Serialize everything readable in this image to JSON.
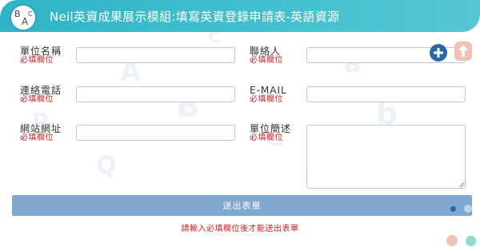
{
  "header": {
    "logo_letters": [
      "B",
      "A",
      "C"
    ],
    "title": "Neil英資成果展示模組:填寫英資登錄申請表-英語資源"
  },
  "required_text": "必填欄位",
  "fields": {
    "unit_name": {
      "label": "單位名稱",
      "value": ""
    },
    "contact": {
      "label": "聯絡人",
      "value": ""
    },
    "phone": {
      "label": "連絡電話",
      "value": ""
    },
    "email": {
      "label": "E-MAIL",
      "value": ""
    },
    "website": {
      "label": "網站網址",
      "value": ""
    },
    "description": {
      "label": "單位簡述",
      "value": ""
    }
  },
  "buttons": {
    "add_icon": "plus-circle-icon",
    "up_icon": "arrow-up-icon",
    "submit_label": "送出表單"
  },
  "notice": "請輸入必填欄位後才能送出表單",
  "colors": {
    "header": "#44c0d0",
    "required": "#d62020",
    "submit": "#7fa7cf",
    "add": "#2a67a8",
    "up": "#f2bfb3"
  }
}
